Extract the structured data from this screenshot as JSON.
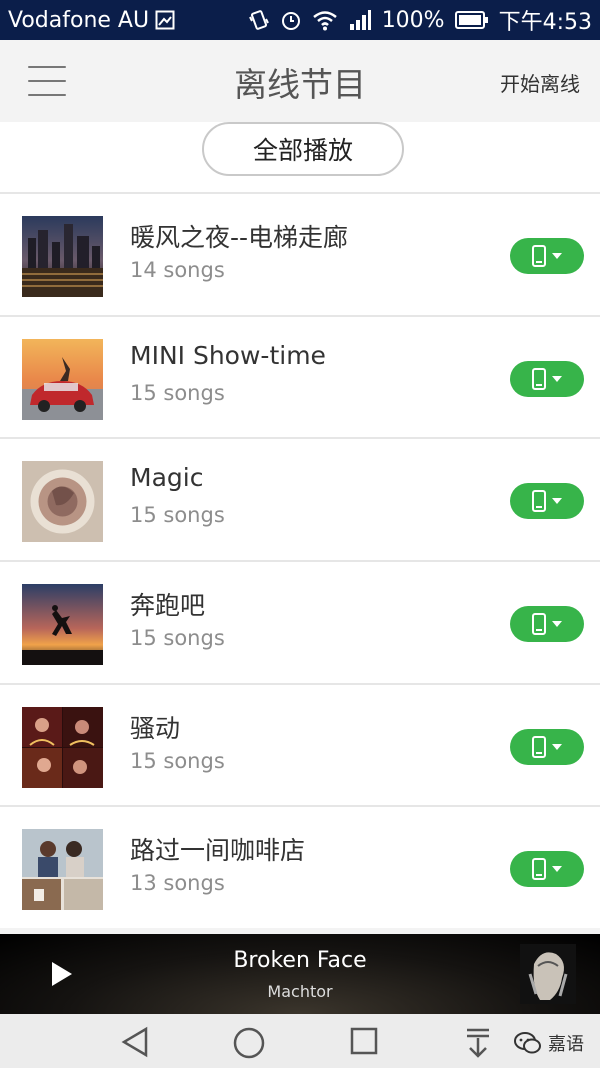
{
  "status_bar": {
    "carrier": "Vodafone AU",
    "battery": "100%",
    "time": "下午4:53",
    "icons": [
      "image-icon",
      "vibrate-icon",
      "alarm-icon",
      "wifi-icon",
      "signal-icon",
      "battery-icon"
    ]
  },
  "header": {
    "title": "离线节目",
    "start_offline": "开始离线",
    "menu_icon": "hamburger-menu-icon"
  },
  "play_all": "全部播放",
  "playlists": [
    {
      "title": "暖风之夜--电梯走廊",
      "count": "14 songs",
      "thumb": "city-night"
    },
    {
      "title": "MINI Show-time",
      "count": "15 songs",
      "thumb": "red-car-sunset"
    },
    {
      "title": "Magic",
      "count": "15 songs",
      "thumb": "circle-portrait"
    },
    {
      "title": "奔跑吧",
      "count": "15 songs",
      "thumb": "jump-silhouette"
    },
    {
      "title": "骚动",
      "count": "15 songs",
      "thumb": "party"
    },
    {
      "title": "路过一间咖啡店",
      "count": "13 songs",
      "thumb": "cafe-couple"
    }
  ],
  "download_button_icon": "phone-download-icon",
  "player": {
    "song": "Broken Face",
    "artist": "Machtor"
  },
  "navbar": {
    "icons": [
      "back-icon",
      "home-icon",
      "recents-icon",
      "notifications-icon"
    ]
  },
  "watermark": "嘉语",
  "colors": {
    "status_bar": "#0b1e4a",
    "accent_green": "#37b44a",
    "background": "#f3f3f3"
  }
}
